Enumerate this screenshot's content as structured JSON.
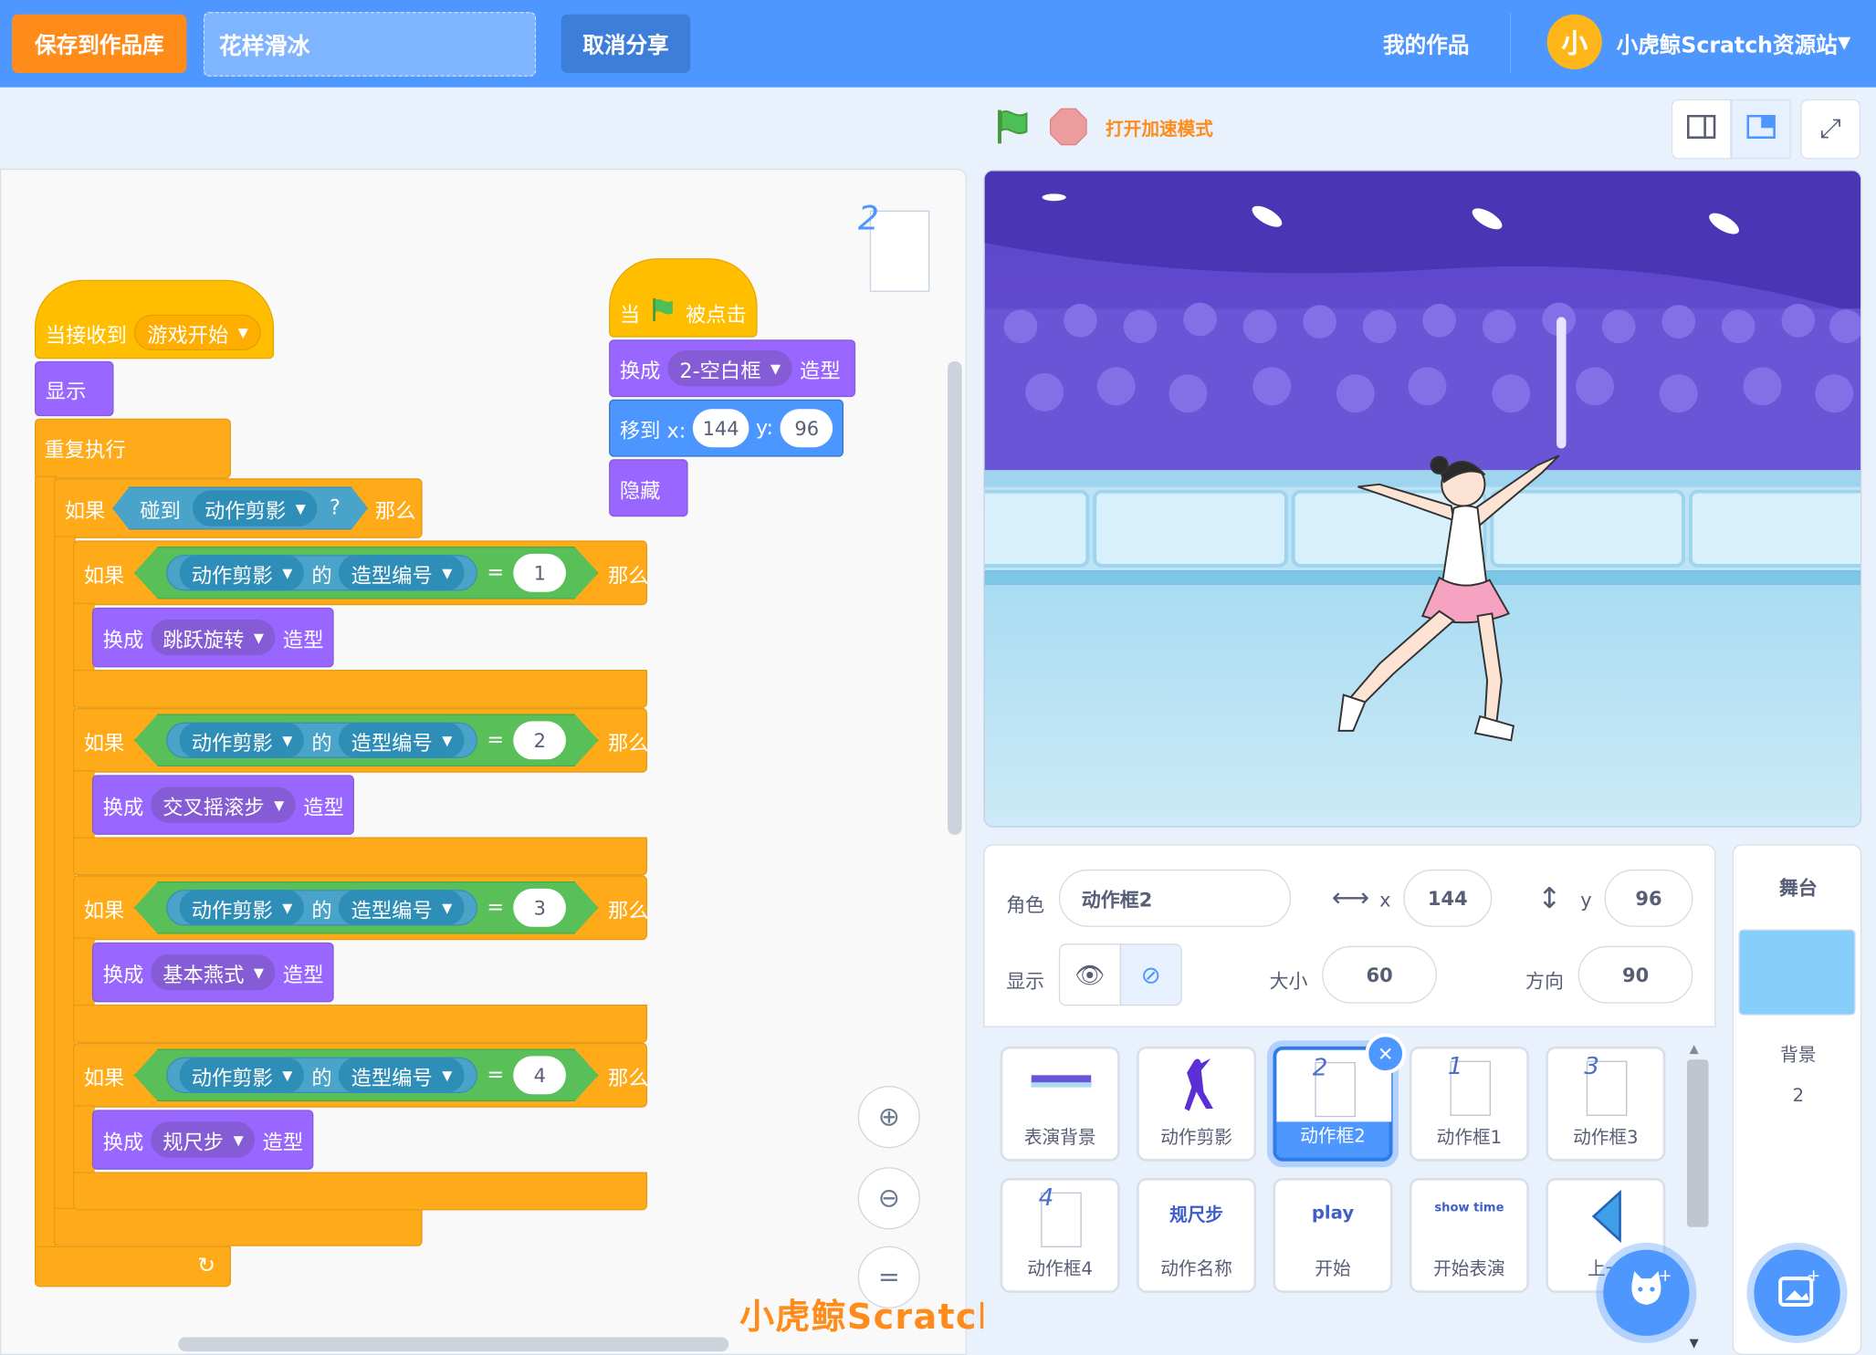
{
  "topbar": {
    "save_button": "保存到作品库",
    "project_title": "花样滑冰",
    "unshare_button": "取消分享",
    "my_works": "我的作品",
    "avatar_text": "小",
    "account_name": "小虎鲸Scratch资源站"
  },
  "toolbar": {
    "turbo_mode": "打开加速模式"
  },
  "code": {
    "costume_label": "2",
    "script1": {
      "hat": "当接收到",
      "hat_msg": "游戏开始",
      "show": "显示",
      "forever": "重复执行",
      "if": "如果",
      "then": "那么",
      "touching": "碰到",
      "touching_target": "动作剪影",
      "question": "?",
      "of": "的",
      "costume_num": "造型编号",
      "eq": "=",
      "switch": "换成",
      "costume": "造型",
      "cases": [
        {
          "value": "1",
          "costume": "跳跃旋转"
        },
        {
          "value": "2",
          "costume": "交叉摇滚步"
        },
        {
          "value": "3",
          "costume": "基本燕式"
        },
        {
          "value": "4",
          "costume": "规尺步"
        }
      ],
      "loop_arrow": "↻"
    },
    "script2": {
      "when": "当",
      "clicked": "被点击",
      "switch": "换成",
      "costume_name": "2-空白框",
      "costume": "造型",
      "goto": "移到 x:",
      "x": "144",
      "y_label": "y:",
      "y": "96",
      "hide": "隐藏"
    },
    "zoom_reset": "="
  },
  "watermark": "小虎鲸Scratch资源站",
  "sprite_info": {
    "sprite_label": "角色",
    "sprite_name": "动作框2",
    "x_label": "x",
    "x": "144",
    "y_label": "y",
    "y": "96",
    "show_label": "显示",
    "size_label": "大小",
    "size": "60",
    "direction_label": "方向",
    "direction": "90"
  },
  "sprites": [
    {
      "name": "表演背景",
      "thumb": ""
    },
    {
      "name": "动作剪影",
      "thumb": ""
    },
    {
      "name": "动作框2",
      "thumb": "2",
      "selected": true
    },
    {
      "name": "动作框1",
      "thumb": "1"
    },
    {
      "name": "动作框3",
      "thumb": "3"
    },
    {
      "name": "动作框4",
      "thumb": "4"
    },
    {
      "name": "动作名称",
      "thumb": "规尺步"
    },
    {
      "name": "开始",
      "thumb": "play"
    },
    {
      "name": "开始表演",
      "thumb": "show time"
    },
    {
      "name": "上一",
      "thumb": ""
    }
  ],
  "stage_panel": {
    "title": "舞台",
    "backdrop_label": "背景",
    "backdrop_count": "2"
  },
  "colors": {
    "accent": "#4d97ff",
    "orange": "#ff8c1a",
    "control": "#ffab19",
    "looks": "#9966ff",
    "motion": "#4c97ff",
    "sensing": "#5cb1d6",
    "operators": "#59c059"
  }
}
